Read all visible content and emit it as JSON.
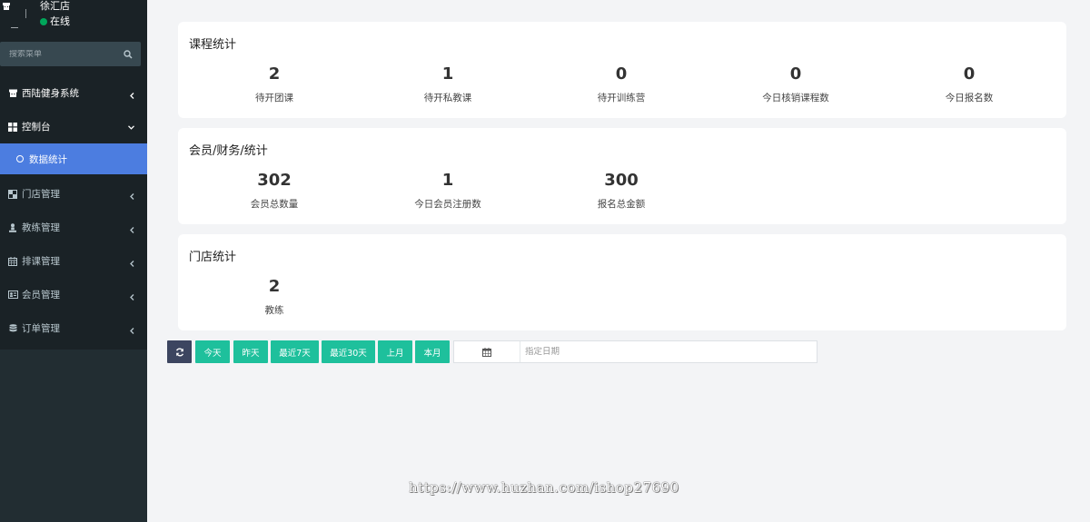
{
  "sidebar": {
    "store_name": "徐汇店",
    "status": "在线",
    "search_placeholder": "搜索菜单",
    "items": [
      {
        "label": "西陆健身系统",
        "icon": "hat-icon"
      },
      {
        "label": "控制台",
        "icon": "grid-icon"
      },
      {
        "label": "数据统计",
        "icon": "circle-icon"
      },
      {
        "label": "门店管理",
        "icon": "store-icon"
      },
      {
        "label": "教练管理",
        "icon": "coach-icon"
      },
      {
        "label": "排课管理",
        "icon": "calendar-icon"
      },
      {
        "label": "会员管理",
        "icon": "id-card-icon"
      },
      {
        "label": "订单管理",
        "icon": "database-icon"
      }
    ]
  },
  "cards": {
    "course": {
      "title": "课程统计",
      "stats": [
        {
          "value": "2",
          "label": "待开团课"
        },
        {
          "value": "1",
          "label": "待开私教课"
        },
        {
          "value": "0",
          "label": "待开训练营"
        },
        {
          "value": "0",
          "label": "今日核销课程数"
        },
        {
          "value": "0",
          "label": "今日报名数"
        }
      ]
    },
    "member": {
      "title": "会员/财务/统计",
      "stats": [
        {
          "value": "302",
          "label": "会员总数量"
        },
        {
          "value": "1",
          "label": "今日会员注册数"
        },
        {
          "value": "300",
          "label": "报名总金额"
        }
      ]
    },
    "store": {
      "title": "门店统计",
      "stats": [
        {
          "value": "2",
          "label": "教练"
        }
      ]
    }
  },
  "toolbar": {
    "buttons": [
      "今天",
      "昨天",
      "最近7天",
      "最近30天",
      "上月",
      "本月"
    ],
    "date_placeholder": "指定日期"
  },
  "watermark": "https://www.huzhan.com/ishop27690",
  "colors": {
    "sidebar_bg": "#222d32",
    "active": "#4c7de0",
    "green_button": "#1ec09c",
    "refresh_button": "#3c4560",
    "online": "#00a65a"
  }
}
